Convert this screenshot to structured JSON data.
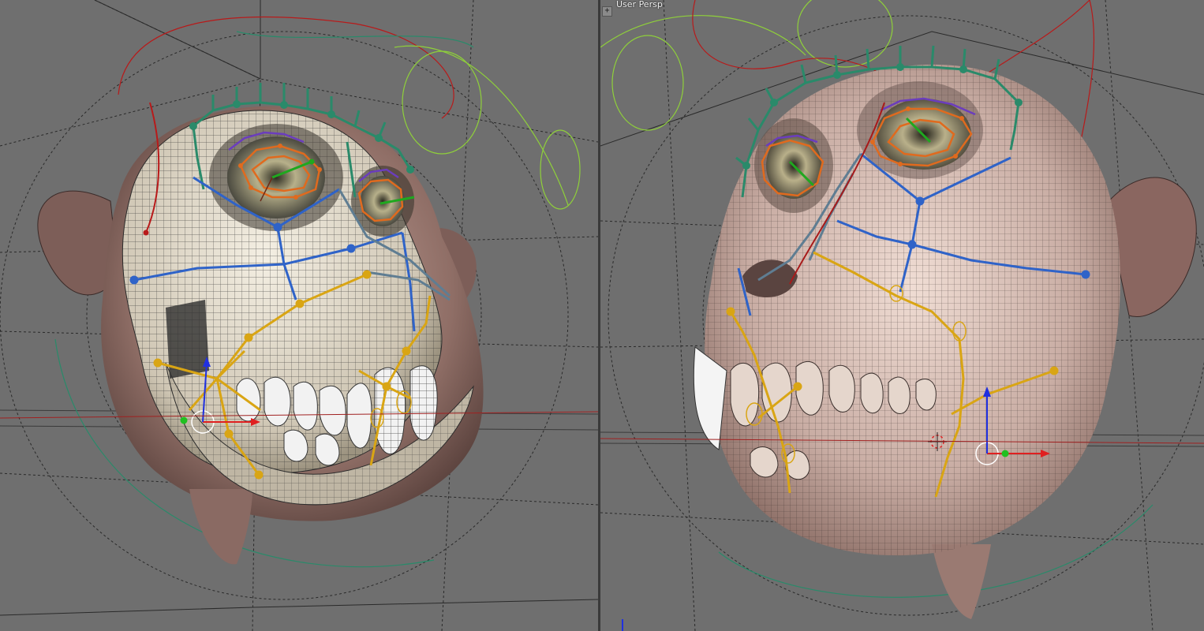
{
  "viewports": {
    "left": {
      "label": "",
      "scene": "skull-rig-side"
    },
    "right": {
      "label": "User Persp",
      "corner_button": "+",
      "scene": "skull-rig-front"
    }
  },
  "colors": {
    "background": "#6f6f6f",
    "grid": "#2a2a2a",
    "skin": "#a8847a",
    "bone": "#e8e2d4",
    "wire": "#222222",
    "bone_blue": "#2f63c8",
    "bone_teal": "#2a8a6a",
    "bone_yellow": "#d9a514",
    "bone_orange": "#e06a1e",
    "bone_purple": "#6b3dbd",
    "curve_green": "#8fd03a",
    "curve_red": "#b81a1a",
    "axis_red": "#e02020",
    "axis_green": "#20c020",
    "axis_blue": "#2030e0"
  }
}
